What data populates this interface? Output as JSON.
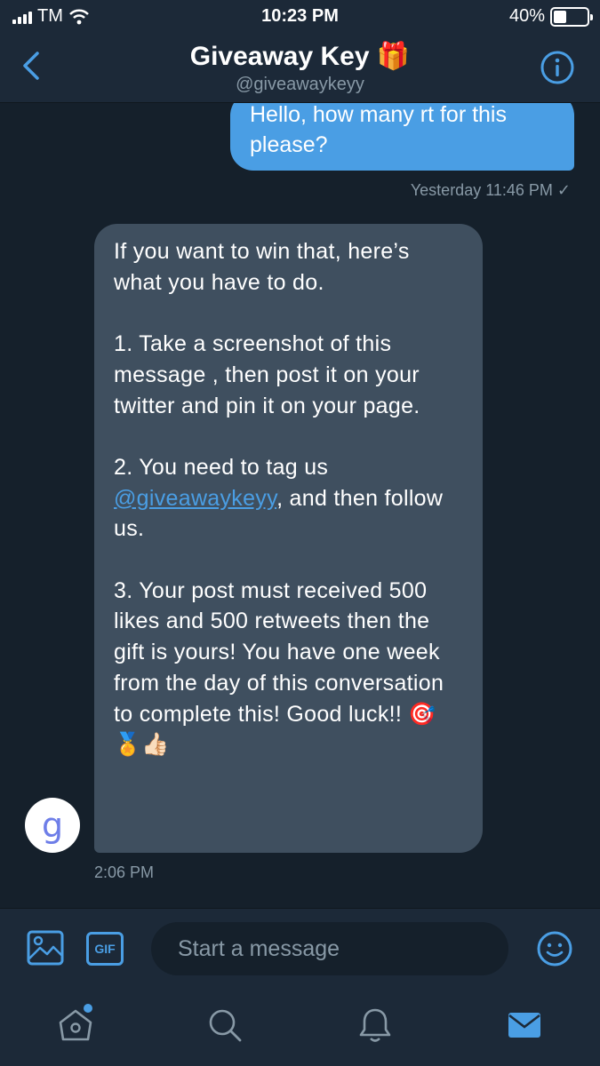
{
  "status_bar": {
    "carrier": "TM",
    "time": "10:23 PM",
    "battery_percent": "40%",
    "battery_level": 0.4
  },
  "header": {
    "title": "Giveaway Key 🎁",
    "handle": "@giveawaykeyy",
    "back_icon": "chevron-left-icon",
    "info_icon": "info-icon"
  },
  "messages": {
    "outgoing": {
      "text": "Hello, how many rt for this please?",
      "timestamp": "Yesterday 11:46 PM ✓"
    },
    "incoming": {
      "line1": "If you want to win that, here’s what you have to do.",
      "step1": "1. Take a screenshot of this message , then post it on your twitter and pin it on your page.",
      "step2_prefix": "2. You need to tag us",
      "step2_mention": "@giveawaykeyy",
      "step2_suffix": ", and then follow us.",
      "step3": "3. Your post must received 500 likes and 500 retweets then the gift is yours! You have one week from the day of this conversation to complete this! Good luck!! 🎯 🏅👍🏻",
      "timestamp": "2:06 PM",
      "avatar_letter": "g"
    }
  },
  "composer": {
    "placeholder": "Start a message",
    "gif_label": "GIF",
    "image_icon": "image-icon",
    "emoji_icon": "emoji-icon"
  },
  "tabs": [
    {
      "name": "home",
      "icon": "home-icon",
      "has_badge": true
    },
    {
      "name": "search",
      "icon": "search-icon"
    },
    {
      "name": "notifications",
      "icon": "bell-icon"
    },
    {
      "name": "messages",
      "icon": "mail-icon",
      "active": true
    }
  ],
  "colors": {
    "background": "#15202b",
    "bar": "#1c2938",
    "accent": "#4a9ee4",
    "incoming_bubble": "#3f4f5f",
    "muted_text": "#8899a6"
  }
}
